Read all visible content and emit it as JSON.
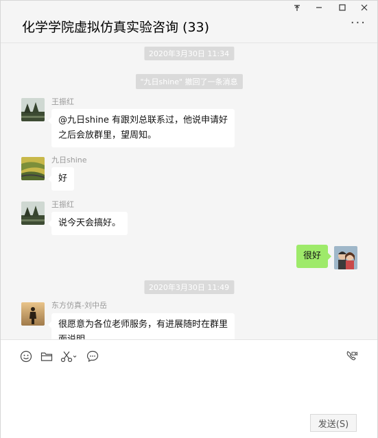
{
  "window": {
    "title": "化学学院虚拟仿真实验咨询 (33)",
    "pin_glyph": "⊼",
    "more_glyph": "···"
  },
  "chat": {
    "timestamps": [
      "2020年3月30日 11:34",
      "2020年3月30日 11:49"
    ],
    "system_message": "\"九日shine\" 撤回了一条消息",
    "messages": [
      {
        "sender": "王振红",
        "lines": [
          "@九日shine  有跟刘总联系过，他说申请好",
          "之后会放群里，望周知。"
        ],
        "avatar": "landscape-avatar"
      },
      {
        "sender": "九日shine",
        "lines": [
          "好"
        ],
        "avatar": "field-avatar"
      },
      {
        "sender": "王振红",
        "lines": [
          "说今天会搞好。"
        ],
        "avatar": "landscape-avatar"
      },
      {
        "sender": "",
        "lines": [
          "很好"
        ],
        "avatar": "couple-avatar",
        "self": true
      },
      {
        "sender": "东方仿真-刘中岳",
        "lines": [
          "很愿意为各位老师服务，有进展随时在群里",
          "面说明"
        ],
        "avatar": "silhouette-avatar"
      }
    ]
  },
  "toolbar": {
    "icons": [
      "emoji-icon",
      "folder-icon",
      "scissors-icon",
      "chat-history-icon",
      "video-call-icon"
    ]
  },
  "compose": {
    "send_label": "发送(S)"
  },
  "colors": {
    "self_bubble": "#9eea6a",
    "other_bubble": "#ffffff",
    "background": "#f5f5f5"
  }
}
